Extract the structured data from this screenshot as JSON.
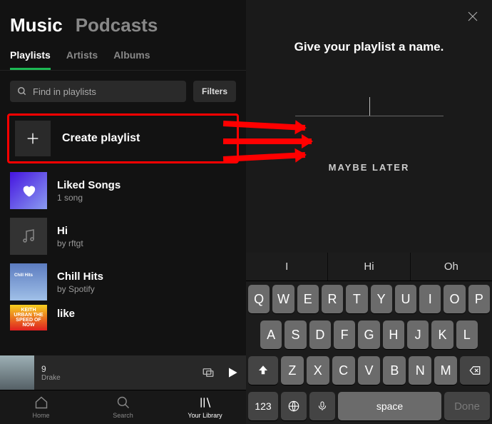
{
  "topTabs": {
    "music": "Music",
    "podcasts": "Podcasts"
  },
  "subTabs": {
    "playlists": "Playlists",
    "artists": "Artists",
    "albums": "Albums"
  },
  "search": {
    "placeholder": "Find in playlists"
  },
  "filters": {
    "label": "Filters"
  },
  "create": {
    "label": "Create playlist"
  },
  "items": [
    {
      "title": "Liked Songs",
      "sub": "1 song"
    },
    {
      "title": "Hi",
      "sub": "by rftgt"
    },
    {
      "title": "Chill Hits",
      "sub": "by Spotify"
    },
    {
      "title": "like",
      "sub": ""
    }
  ],
  "nowPlaying": {
    "title": "9",
    "artist": "Drake"
  },
  "nav": {
    "home": "Home",
    "search": "Search",
    "library": "Your Library"
  },
  "rightPane": {
    "prompt": "Give your playlist a name.",
    "maybeLater": "MAYBE LATER"
  },
  "keyboard": {
    "suggestions": [
      "I",
      "Hi",
      "Oh"
    ],
    "row1": [
      "Q",
      "W",
      "E",
      "R",
      "T",
      "Y",
      "U",
      "I",
      "O",
      "P"
    ],
    "row2": [
      "A",
      "S",
      "D",
      "F",
      "G",
      "H",
      "J",
      "K",
      "L"
    ],
    "row3": [
      "Z",
      "X",
      "C",
      "V",
      "B",
      "N",
      "M"
    ],
    "numKey": "123",
    "space": "space",
    "done": "Done"
  },
  "thumbText": {
    "likeCover": "KEITH URBAN THE SPEED OF NOW"
  }
}
